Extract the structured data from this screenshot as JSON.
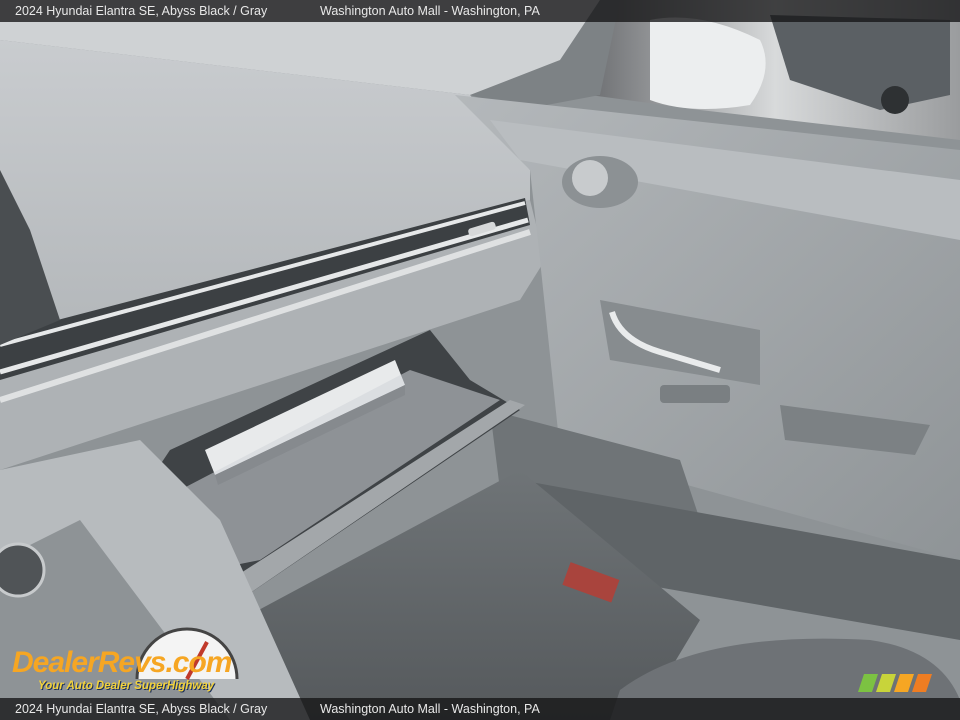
{
  "header": {
    "vehicle": "2024 Hyundai Elantra SE,  Abyss Black / Gray",
    "dealer": "Washington Auto Mall - Washington, PA"
  },
  "footer": {
    "vehicle": "2024 Hyundai Elantra SE,  Abyss Black / Gray",
    "dealer": "Washington Auto Mall - Washington, PA"
  },
  "watermark": {
    "brand": "DealerRevs.com",
    "tagline": "Your Auto Dealer SuperHighway"
  },
  "colors": {
    "dash": "#b8bbbd",
    "door_panel": "#9ea3a6",
    "caption_bar": "#141416",
    "logo_orange": "#f6a623",
    "logo_blue": "#2f5fa8",
    "tagline_yellow": "#f3d23b"
  }
}
